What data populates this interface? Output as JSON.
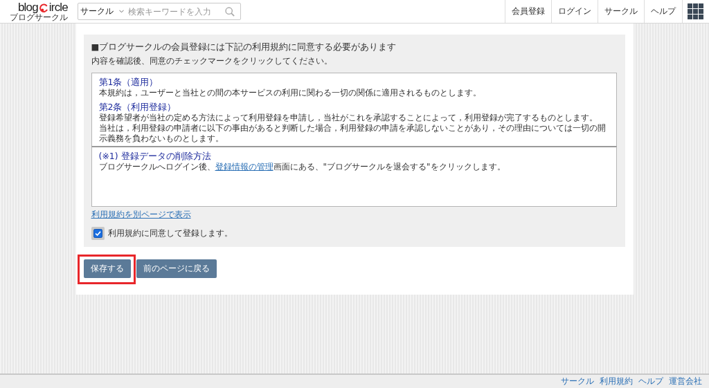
{
  "header": {
    "logo": {
      "word_start": "blog",
      "word_end": "ircle",
      "tagline": "ブログサークル"
    },
    "search": {
      "category": "サークル",
      "placeholder": "検索キーワードを入力"
    },
    "nav": [
      {
        "label": "会員登録"
      },
      {
        "label": "ログイン"
      },
      {
        "label": "サークル"
      },
      {
        "label": "ヘルプ"
      }
    ]
  },
  "form": {
    "heading": "■ブログサークルの会員登録には下記の利用規約に同意する必要があります",
    "instruction": "内容を確認後、同意のチェックマークをクリックしてください。",
    "terms": [
      {
        "title": "第1条（適用）",
        "paragraphs": [
          "本規約は，ユーザーと当社との間の本サービスの利用に関わる一切の関係に適用されるものとします。"
        ]
      },
      {
        "title": "第2条（利用登録）",
        "paragraphs": [
          "登録希望者が当社の定める方法によって利用登録を申請し，当社がこれを承認することによって，利用登録が完了するものとします。",
          "当社は，利用登録の申請者に以下の事由があると判断した場合，利用登録の申請を承認しないことがあり，その理由については一切の開示義務を負わないものとします。"
        ]
      }
    ],
    "deletion": {
      "title": "(※1) 登録データの削除方法",
      "parts": [
        {
          "kind": "text",
          "text": "ブログサークルへログイン後、"
        },
        {
          "kind": "link",
          "text": "登録情報の管理"
        },
        {
          "kind": "text",
          "text": "画面にある、\"ブログサークルを退会する\"をクリックします。"
        }
      ]
    },
    "terms_link": "利用規約を別ページで表示",
    "agree": {
      "label": "利用規約に同意して登録します。",
      "checked": true
    }
  },
  "buttons": [
    {
      "label": "保存する",
      "highlighted": true
    },
    {
      "label": "前のページに戻る",
      "highlighted": false
    }
  ],
  "footer": {
    "links": [
      "サークル",
      "利用規約",
      "ヘルプ",
      "運営会社"
    ]
  }
}
